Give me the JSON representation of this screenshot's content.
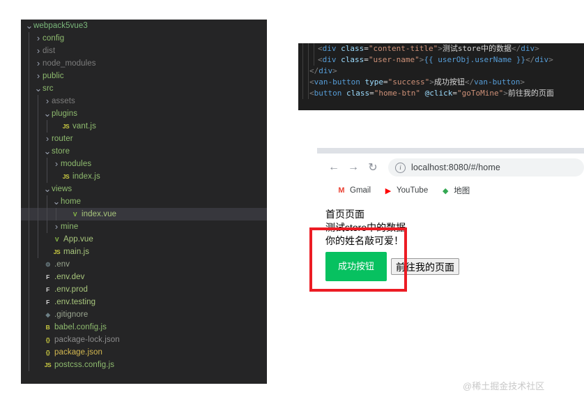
{
  "explorer": {
    "name": "file-explorer",
    "tree": [
      {
        "label": "webpack5vue3",
        "depth": 0,
        "twisty": "chevron-down",
        "icon": "",
        "iconColor": "",
        "color": "#7ab77a",
        "selected": false,
        "guides": []
      },
      {
        "label": "config",
        "depth": 1,
        "twisty": "chevron-right",
        "icon": "",
        "iconColor": "",
        "color": "#8fbc6f",
        "selected": false,
        "guides": []
      },
      {
        "label": "dist",
        "depth": 1,
        "twisty": "chevron-right",
        "icon": "",
        "iconColor": "",
        "color": "#7d7d7d",
        "selected": false,
        "guides": []
      },
      {
        "label": "node_modules",
        "depth": 1,
        "twisty": "chevron-right",
        "icon": "",
        "iconColor": "",
        "color": "#7d7d7d",
        "selected": false,
        "guides": []
      },
      {
        "label": "public",
        "depth": 1,
        "twisty": "chevron-right",
        "icon": "",
        "iconColor": "",
        "color": "#8fbc6f",
        "selected": false,
        "guides": []
      },
      {
        "label": "src",
        "depth": 1,
        "twisty": "chevron-down",
        "icon": "",
        "iconColor": "",
        "color": "#8fbc6f",
        "selected": false,
        "guides": []
      },
      {
        "label": "assets",
        "depth": 2,
        "twisty": "chevron-right",
        "icon": "",
        "iconColor": "",
        "color": "#7d7d7d",
        "selected": false,
        "guides": []
      },
      {
        "label": "plugins",
        "depth": 2,
        "twisty": "chevron-down",
        "icon": "",
        "iconColor": "",
        "color": "#8fbc6f",
        "selected": false,
        "guides": []
      },
      {
        "label": "vant.js",
        "depth": 3,
        "twisty": "",
        "icon": "JS",
        "iconColor": "#cbcb41",
        "color": "#8fbc6f",
        "selected": false,
        "guides": []
      },
      {
        "label": "router",
        "depth": 2,
        "twisty": "chevron-right",
        "icon": "",
        "iconColor": "",
        "color": "#8fbc6f",
        "selected": false,
        "guides": []
      },
      {
        "label": "store",
        "depth": 2,
        "twisty": "chevron-down",
        "icon": "",
        "iconColor": "",
        "color": "#8fbc6f",
        "selected": false,
        "guides": []
      },
      {
        "label": "modules",
        "depth": 3,
        "twisty": "chevron-right",
        "icon": "",
        "iconColor": "",
        "color": "#8fbc6f",
        "selected": false,
        "guides": []
      },
      {
        "label": "index.js",
        "depth": 3,
        "twisty": "",
        "icon": "JS",
        "iconColor": "#cbcb41",
        "color": "#8fbc6f",
        "selected": false,
        "guides": []
      },
      {
        "label": "views",
        "depth": 2,
        "twisty": "chevron-down",
        "icon": "",
        "iconColor": "",
        "color": "#8fbc6f",
        "selected": false,
        "guides": []
      },
      {
        "label": "home",
        "depth": 3,
        "twisty": "chevron-down",
        "icon": "",
        "iconColor": "",
        "color": "#8fbc6f",
        "selected": false,
        "guides": []
      },
      {
        "label": "index.vue",
        "depth": 4,
        "twisty": "",
        "icon": "V",
        "iconColor": "#8dc149",
        "color": "#a9c77d",
        "selected": true,
        "guides": []
      },
      {
        "label": "mine",
        "depth": 3,
        "twisty": "chevron-right",
        "icon": "",
        "iconColor": "",
        "color": "#8fbc6f",
        "selected": false,
        "guides": []
      },
      {
        "label": "App.vue",
        "depth": 2,
        "twisty": "",
        "icon": "V",
        "iconColor": "#8dc149",
        "color": "#a9c77d",
        "selected": false,
        "guides": []
      },
      {
        "label": "main.js",
        "depth": 2,
        "twisty": "",
        "icon": "JS",
        "iconColor": "#cbcb41",
        "color": "#a9c77d",
        "selected": false,
        "guides": []
      },
      {
        "label": ".env",
        "depth": 1,
        "twisty": "",
        "icon": "⚙",
        "iconColor": "#6d8086",
        "color": "#9aa58f",
        "selected": false,
        "guides": []
      },
      {
        "label": ".env.dev",
        "depth": 1,
        "twisty": "",
        "icon": "F",
        "iconColor": "#d4d4d4",
        "color": "#a9c77d",
        "selected": false,
        "guides": []
      },
      {
        "label": ".env.prod",
        "depth": 1,
        "twisty": "",
        "icon": "F",
        "iconColor": "#d4d4d4",
        "color": "#a9c77d",
        "selected": false,
        "guides": []
      },
      {
        "label": ".env.testing",
        "depth": 1,
        "twisty": "",
        "icon": "F",
        "iconColor": "#d4d4d4",
        "color": "#a9c77d",
        "selected": false,
        "guides": []
      },
      {
        "label": ".gitignore",
        "depth": 1,
        "twisty": "",
        "icon": "◆",
        "iconColor": "#6d8086",
        "color": "#9aa58f",
        "selected": false,
        "guides": []
      },
      {
        "label": "babel.config.js",
        "depth": 1,
        "twisty": "",
        "icon": "B",
        "iconColor": "#cbcb41",
        "color": "#8fbc6f",
        "selected": false,
        "guides": []
      },
      {
        "label": "package-lock.json",
        "depth": 1,
        "twisty": "",
        "icon": "{}",
        "iconColor": "#cbcb41",
        "color": "#8d8d8d",
        "selected": false,
        "guides": []
      },
      {
        "label": "package.json",
        "depth": 1,
        "twisty": "",
        "icon": "{}",
        "iconColor": "#cbcb41",
        "color": "#d4b850",
        "selected": false,
        "guides": []
      },
      {
        "label": "postcss.config.js",
        "depth": 1,
        "twisty": "",
        "icon": "JS",
        "iconColor": "#cbcb41",
        "color": "#8fbc6f",
        "selected": false,
        "guides": []
      }
    ]
  },
  "code": {
    "name": "code-snippet",
    "lines": [
      {
        "indent": 26,
        "guides": [
          6,
          14,
          22
        ],
        "tokens": [
          {
            "t": "<",
            "c": "pk"
          },
          {
            "t": "div",
            "c": "tag"
          },
          {
            "t": " ",
            "c": "txt"
          },
          {
            "t": "class",
            "c": "attr"
          },
          {
            "t": "=",
            "c": "eq"
          },
          {
            "t": "\"content-title\"",
            "c": "str"
          },
          {
            "t": ">",
            "c": "pk"
          },
          {
            "t": "测试store中的数据",
            "c": "txt"
          },
          {
            "t": "</",
            "c": "pk"
          },
          {
            "t": "div",
            "c": "tag"
          },
          {
            "t": ">",
            "c": "pk"
          }
        ]
      },
      {
        "indent": 26,
        "guides": [
          6,
          14,
          22
        ],
        "tokens": [
          {
            "t": "<",
            "c": "pk"
          },
          {
            "t": "div",
            "c": "tag"
          },
          {
            "t": " ",
            "c": "txt"
          },
          {
            "t": "class",
            "c": "attr"
          },
          {
            "t": "=",
            "c": "eq"
          },
          {
            "t": "\"user-name\"",
            "c": "str"
          },
          {
            "t": ">",
            "c": "pk"
          },
          {
            "t": "{{ userObj.userName }}",
            "c": "mus"
          },
          {
            "t": "</",
            "c": "pk"
          },
          {
            "t": "div",
            "c": "tag"
          },
          {
            "t": ">",
            "c": "pk"
          }
        ]
      },
      {
        "indent": 14,
        "guides": [
          6,
          14
        ],
        "tokens": [
          {
            "t": "</",
            "c": "pk"
          },
          {
            "t": "div",
            "c": "tag"
          },
          {
            "t": ">",
            "c": "pk"
          }
        ]
      },
      {
        "indent": 14,
        "guides": [
          6,
          14
        ],
        "tokens": [
          {
            "t": "<",
            "c": "pk"
          },
          {
            "t": "van-button",
            "c": "tag"
          },
          {
            "t": " ",
            "c": "txt"
          },
          {
            "t": "type",
            "c": "attr"
          },
          {
            "t": "=",
            "c": "eq"
          },
          {
            "t": "\"success\"",
            "c": "str"
          },
          {
            "t": ">",
            "c": "pk"
          },
          {
            "t": "成功按钮",
            "c": "txt"
          },
          {
            "t": "</",
            "c": "pk"
          },
          {
            "t": "van-button",
            "c": "tag"
          },
          {
            "t": ">",
            "c": "pk"
          }
        ]
      },
      {
        "indent": 14,
        "guides": [
          6,
          14
        ],
        "tokens": [
          {
            "t": "<",
            "c": "pk"
          },
          {
            "t": "button",
            "c": "tag"
          },
          {
            "t": " ",
            "c": "txt"
          },
          {
            "t": "class",
            "c": "attr"
          },
          {
            "t": "=",
            "c": "eq"
          },
          {
            "t": "\"home-btn\"",
            "c": "str"
          },
          {
            "t": " ",
            "c": "txt"
          },
          {
            "t": "@click",
            "c": "attr"
          },
          {
            "t": "=",
            "c": "eq"
          },
          {
            "t": "\"goToMine\"",
            "c": "str"
          },
          {
            "t": ">",
            "c": "pk"
          },
          {
            "t": "前往我的页面",
            "c": "txt"
          }
        ]
      }
    ]
  },
  "browser": {
    "back_icon": "←",
    "forward_icon": "→",
    "reload_icon": "↻",
    "info_icon": "i",
    "url": "localhost:8080/#/home",
    "bookmarks": [
      {
        "label": "Gmail",
        "icon": "M",
        "color": "#ea4335"
      },
      {
        "label": "YouTube",
        "icon": "▶",
        "color": "#ff0000"
      },
      {
        "label": "地图",
        "icon": "◆",
        "color": "#34a853"
      }
    ],
    "page": {
      "line1": "首页页面",
      "line2": "测试store中的数据",
      "line3": "你的姓名敲可爱！",
      "success_button": "成功按钮",
      "mine_button": "前往我的页面"
    }
  },
  "annotation": {
    "color": "#ec1c24"
  },
  "watermark": {
    "text": "@稀土掘金技术社区"
  }
}
